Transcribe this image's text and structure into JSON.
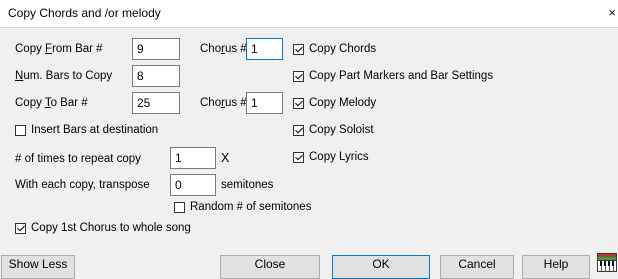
{
  "window": {
    "title": "Copy Chords and /or melody",
    "close_glyph": "×"
  },
  "fields": {
    "copy_from_bar": {
      "pre": "Copy ",
      "u": "F",
      "post": "rom Bar #",
      "value": "9"
    },
    "num_bars": {
      "pre": "",
      "u": "N",
      "post": "um. Bars to Copy",
      "value": "8"
    },
    "copy_to_bar": {
      "pre": "Copy ",
      "u": "T",
      "post": "o Bar #",
      "value": "25"
    },
    "chorus_from": {
      "pre": "Cho",
      "u": "r",
      "post": "us #",
      "value": "1"
    },
    "chorus_to": {
      "pre": "Cho",
      "u": "r",
      "post": "us #",
      "value": "1"
    },
    "repeat": {
      "label": "# of times to repeat copy",
      "value": "1",
      "suffix": "X"
    },
    "transpose": {
      "label": "With each copy, transpose",
      "value": "0",
      "suffix": "semitones"
    }
  },
  "checkboxes": {
    "copy_chords": {
      "label": "Copy Chords",
      "checked": true
    },
    "copy_part_markers": {
      "label": "Copy Part Markers and Bar Settings",
      "checked": true
    },
    "copy_melody": {
      "label": "Copy Melody",
      "checked": true
    },
    "copy_soloist": {
      "label": "Copy Soloist",
      "checked": true
    },
    "copy_lyrics": {
      "label": "Copy Lyrics",
      "checked": true
    },
    "insert_bars": {
      "label": "Insert Bars at destination",
      "checked": false
    },
    "random_semitones": {
      "label": "Random # of semitones",
      "checked": false
    },
    "copy_first_chorus": {
      "label": "Copy 1st Chorus to whole song",
      "checked": true
    }
  },
  "buttons": {
    "show_less": "Show Less",
    "close": "Close",
    "ok": "OK",
    "cancel": "Cancel",
    "help": "Help"
  },
  "icons": {
    "corner": "piano-keyboard-icon"
  },
  "colors": {
    "focus_border": "#0078d7",
    "title_bg": "#ffffff",
    "dialog_bg": "#f0f0f0"
  }
}
